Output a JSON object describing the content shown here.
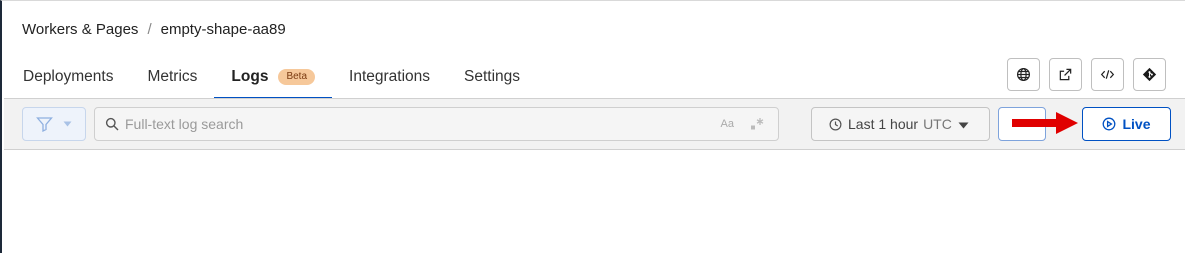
{
  "breadcrumb": {
    "parent": "Workers & Pages",
    "separator": "/",
    "current": "empty-shape-aa89"
  },
  "tabs": [
    {
      "label": "Deployments",
      "active": false
    },
    {
      "label": "Metrics",
      "active": false
    },
    {
      "label": "Logs",
      "active": true,
      "badge": "Beta"
    },
    {
      "label": "Integrations",
      "active": false
    },
    {
      "label": "Settings",
      "active": false
    }
  ],
  "header_actions": [
    "globe-icon",
    "external-link-icon",
    "code-icon",
    "git-icon"
  ],
  "toolbar": {
    "search_placeholder": "Full-text log search",
    "case_toggle": "Aa",
    "time_range_label": "Last 1 hour",
    "timezone": "UTC",
    "live_label": "Live"
  },
  "colors": {
    "accent": "#0051c3",
    "badge_bg": "#f6c89a",
    "annotation_arrow": "#e00000"
  }
}
